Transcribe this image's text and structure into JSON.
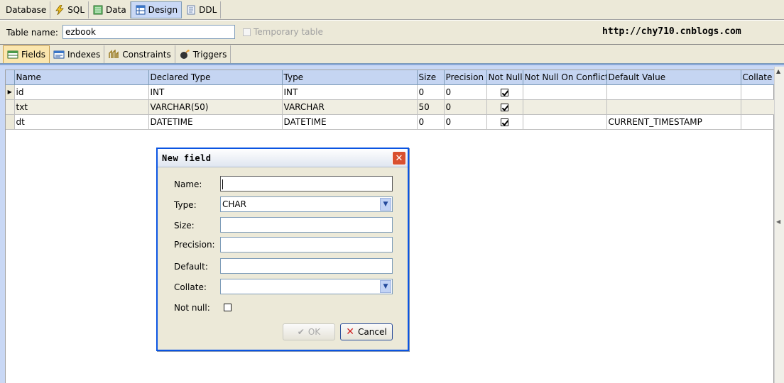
{
  "top_tabs": [
    {
      "label": "Database",
      "active": false
    },
    {
      "label": "SQL",
      "active": false
    },
    {
      "label": "Data",
      "active": false
    },
    {
      "label": "Design",
      "active": true
    },
    {
      "label": "DDL",
      "active": false
    }
  ],
  "table_name": {
    "label": "Table name:",
    "value": "ezbook",
    "temporary_label": "Temporary table",
    "temporary_checked": false
  },
  "url_text": "http://chy710.cnblogs.com",
  "sub_tabs": [
    {
      "label": "Fields",
      "active": true
    },
    {
      "label": "Indexes",
      "active": false
    },
    {
      "label": "Constraints",
      "active": false
    },
    {
      "label": "Triggers",
      "active": false
    }
  ],
  "grid": {
    "columns": [
      "Name",
      "Declared Type",
      "Type",
      "Size",
      "Precision",
      "Not Null",
      "Not Null On Conflict",
      "Default Value",
      "Collate"
    ],
    "rows": [
      {
        "name": "id",
        "declared_type": "INT",
        "type": "INT",
        "size": "0",
        "precision": "0",
        "not_null": true,
        "on_conflict": "",
        "default": "",
        "collate": ""
      },
      {
        "name": "txt",
        "declared_type": "VARCHAR(50)",
        "type": "VARCHAR",
        "size": "50",
        "precision": "0",
        "not_null": true,
        "on_conflict": "",
        "default": "",
        "collate": ""
      },
      {
        "name": "dt",
        "declared_type": "DATETIME",
        "type": "DATETIME",
        "size": "0",
        "precision": "0",
        "not_null": true,
        "on_conflict": "",
        "default": "CURRENT_TIMESTAMP",
        "collate": ""
      }
    ]
  },
  "dialog": {
    "title": "New field",
    "name_label": "Name:",
    "name_value": "",
    "type_label": "Type:",
    "type_value": "CHAR",
    "size_label": "Size:",
    "size_value": "",
    "precision_label": "Precision:",
    "precision_value": "",
    "default_label": "Default:",
    "default_value": "",
    "collate_label": "Collate:",
    "collate_value": "",
    "notnull_label": "Not null:",
    "notnull_checked": false,
    "ok_label": "OK",
    "cancel_label": "Cancel"
  },
  "colors": {
    "chrome": "#ece9d8",
    "grid_header": "#c5d5f2",
    "active_subtab": "#fbe6ae",
    "dialog_border": "#0a54e2",
    "close_button": "#d9502f"
  }
}
